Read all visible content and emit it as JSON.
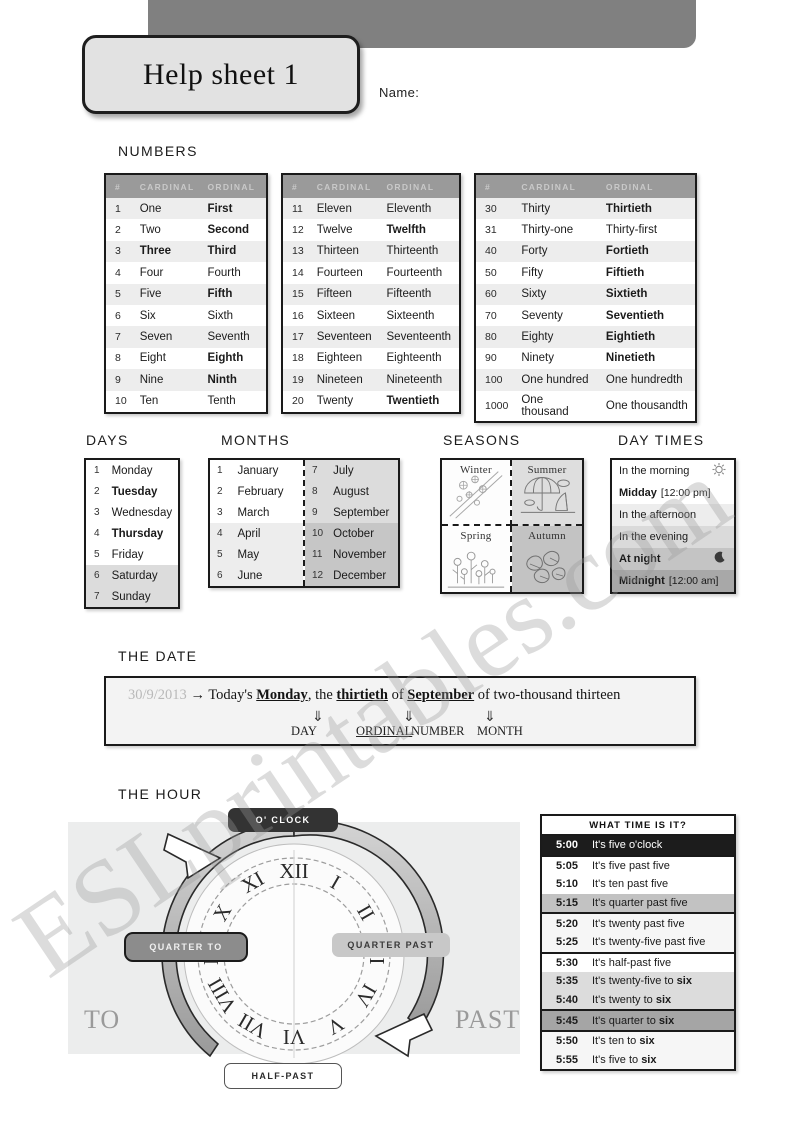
{
  "header": {
    "title": "Help sheet 1",
    "name_label": "Name:"
  },
  "sections": {
    "numbers": "NUMBERS",
    "days": "DAYS",
    "months": "MONTHS",
    "seasons": "SEASONS",
    "day_times": "DAY TIMES",
    "the_date": "THE DATE",
    "the_hour": "THE HOUR"
  },
  "numbers": {
    "columns": [
      "#",
      "CARDINAL",
      "ORDINAL"
    ],
    "table1": [
      {
        "n": "1",
        "cardinal": "One",
        "ordinal": "First",
        "cardinal_bold": false,
        "ordinal_bold": true
      },
      {
        "n": "2",
        "cardinal": "Two",
        "ordinal": "Second",
        "cardinal_bold": false,
        "ordinal_bold": true
      },
      {
        "n": "3",
        "cardinal": "Three",
        "ordinal": "Third",
        "cardinal_bold": true,
        "ordinal_bold": true
      },
      {
        "n": "4",
        "cardinal": "Four",
        "ordinal": "Fourth",
        "cardinal_bold": false,
        "ordinal_bold": false
      },
      {
        "n": "5",
        "cardinal": "Five",
        "ordinal": "Fifth",
        "cardinal_bold": false,
        "ordinal_bold": true
      },
      {
        "n": "6",
        "cardinal": "Six",
        "ordinal": "Sixth",
        "cardinal_bold": false,
        "ordinal_bold": false
      },
      {
        "n": "7",
        "cardinal": "Seven",
        "ordinal": "Seventh",
        "cardinal_bold": false,
        "ordinal_bold": false
      },
      {
        "n": "8",
        "cardinal": "Eight",
        "ordinal": "Eighth",
        "cardinal_bold": false,
        "ordinal_bold": true
      },
      {
        "n": "9",
        "cardinal": "Nine",
        "ordinal": "Ninth",
        "cardinal_bold": false,
        "ordinal_bold": true
      },
      {
        "n": "10",
        "cardinal": "Ten",
        "ordinal": "Tenth",
        "cardinal_bold": false,
        "ordinal_bold": false
      }
    ],
    "table2": [
      {
        "n": "11",
        "cardinal": "Eleven",
        "ordinal": "Eleventh",
        "cardinal_bold": false,
        "ordinal_bold": false
      },
      {
        "n": "12",
        "cardinal": "Twelve",
        "ordinal": "Twelfth",
        "cardinal_bold": false,
        "ordinal_bold": true
      },
      {
        "n": "13",
        "cardinal": "Thirteen",
        "ordinal": "Thirteenth",
        "cardinal_bold": false,
        "ordinal_bold": false
      },
      {
        "n": "14",
        "cardinal": "Fourteen",
        "ordinal": "Fourteenth",
        "cardinal_bold": false,
        "ordinal_bold": false
      },
      {
        "n": "15",
        "cardinal": "Fifteen",
        "ordinal": "Fifteenth",
        "cardinal_bold": false,
        "ordinal_bold": false
      },
      {
        "n": "16",
        "cardinal": "Sixteen",
        "ordinal": "Sixteenth",
        "cardinal_bold": false,
        "ordinal_bold": false
      },
      {
        "n": "17",
        "cardinal": "Seventeen",
        "ordinal": "Seventeenth",
        "cardinal_bold": false,
        "ordinal_bold": false
      },
      {
        "n": "18",
        "cardinal": "Eighteen",
        "ordinal": "Eighteenth",
        "cardinal_bold": false,
        "ordinal_bold": false
      },
      {
        "n": "19",
        "cardinal": "Nineteen",
        "ordinal": "Nineteenth",
        "cardinal_bold": false,
        "ordinal_bold": false
      },
      {
        "n": "20",
        "cardinal": "Twenty",
        "ordinal": "Twentieth",
        "cardinal_bold": false,
        "ordinal_bold": true
      }
    ],
    "table3": [
      {
        "n": "30",
        "cardinal": "Thirty",
        "ordinal": "Thirtieth",
        "cardinal_bold": false,
        "ordinal_bold": true
      },
      {
        "n": "31",
        "cardinal": "Thirty-one",
        "ordinal": "Thirty-first",
        "cardinal_bold": false,
        "ordinal_bold": false
      },
      {
        "n": "40",
        "cardinal": "Forty",
        "ordinal": "Fortieth",
        "cardinal_bold": false,
        "ordinal_bold": true
      },
      {
        "n": "50",
        "cardinal": "Fifty",
        "ordinal": "Fiftieth",
        "cardinal_bold": false,
        "ordinal_bold": true
      },
      {
        "n": "60",
        "cardinal": "Sixty",
        "ordinal": "Sixtieth",
        "cardinal_bold": false,
        "ordinal_bold": true
      },
      {
        "n": "70",
        "cardinal": "Seventy",
        "ordinal": "Seventieth",
        "cardinal_bold": false,
        "ordinal_bold": true
      },
      {
        "n": "80",
        "cardinal": "Eighty",
        "ordinal": "Eightieth",
        "cardinal_bold": false,
        "ordinal_bold": true
      },
      {
        "n": "90",
        "cardinal": "Ninety",
        "ordinal": "Ninetieth",
        "cardinal_bold": false,
        "ordinal_bold": true
      },
      {
        "n": "100",
        "cardinal": "One hundred",
        "ordinal": "One hundredth",
        "cardinal_bold": false,
        "ordinal_bold": false
      },
      {
        "n": "1000",
        "cardinal": "One thousand",
        "ordinal": "One thousandth",
        "cardinal_bold": false,
        "ordinal_bold": false
      }
    ]
  },
  "days": [
    {
      "n": "1",
      "label": "Monday",
      "bold": false,
      "shade": 0
    },
    {
      "n": "2",
      "label": "Tuesday",
      "bold": true,
      "shade": 0
    },
    {
      "n": "3",
      "label": "Wednesday",
      "bold": false,
      "shade": 0
    },
    {
      "n": "4",
      "label": "Thursday",
      "bold": true,
      "shade": 0
    },
    {
      "n": "5",
      "label": "Friday",
      "bold": false,
      "shade": 0
    },
    {
      "n": "6",
      "label": "Saturday",
      "bold": false,
      "shade": 2
    },
    {
      "n": "7",
      "label": "Sunday",
      "bold": false,
      "shade": 2
    }
  ],
  "months_left": [
    {
      "n": "1",
      "label": "January",
      "shade": 0
    },
    {
      "n": "2",
      "label": "February",
      "shade": 0
    },
    {
      "n": "3",
      "label": "March",
      "shade": 0
    },
    {
      "n": "4",
      "label": "April",
      "shade": 1
    },
    {
      "n": "5",
      "label": "May",
      "shade": 1
    },
    {
      "n": "6",
      "label": "June",
      "shade": 1
    }
  ],
  "months_right": [
    {
      "n": "7",
      "label": "July",
      "shade": 2
    },
    {
      "n": "8",
      "label": "August",
      "shade": 2
    },
    {
      "n": "9",
      "label": "September",
      "shade": 2
    },
    {
      "n": "10",
      "label": "October",
      "shade": 3
    },
    {
      "n": "11",
      "label": "November",
      "shade": 3
    },
    {
      "n": "12",
      "label": "December",
      "shade": 3
    }
  ],
  "seasons": [
    {
      "name": "Winter",
      "icon": "snowflakes-icon"
    },
    {
      "name": "Summer",
      "icon": "beach-umbrella-icon"
    },
    {
      "name": "Spring",
      "icon": "flowers-icon"
    },
    {
      "name": "Autumn",
      "icon": "leaves-icon"
    }
  ],
  "day_times": [
    {
      "label": "In the morning",
      "bracket": "",
      "bold": false,
      "shade": 0,
      "icon": "sun-icon"
    },
    {
      "label": "Midday",
      "bracket": "[12:00 pm]",
      "bold": true,
      "shade": 0,
      "icon": ""
    },
    {
      "label": "In the afternoon",
      "bracket": "",
      "bold": false,
      "shade": 1,
      "icon": ""
    },
    {
      "label": "In the evening",
      "bracket": "",
      "bold": false,
      "shade": 2,
      "icon": ""
    },
    {
      "label": "At night",
      "bracket": "",
      "bold": true,
      "shade": 3,
      "icon": "moon-icon"
    },
    {
      "label": "Midnight",
      "bracket": "[12:00 am]",
      "bold": true,
      "shade": 4,
      "icon": ""
    }
  ],
  "the_date": {
    "numeric": "30/9/2013",
    "arrow": "→",
    "pre": "Today's",
    "day": "Monday",
    "mid1": ", the",
    "ordinal": "thirtieth",
    "mid2": "of",
    "month": "September",
    "tail": "of two-thousand thirteen",
    "arrow_down": "⇓",
    "label_day": "DAY",
    "label_ordinal": "ORDINAL",
    "label_number": "NUMBER",
    "label_month": "MONTH"
  },
  "the_hour": {
    "oclock": "O' CLOCK",
    "quarter_to": "QUARTER TO",
    "quarter_past": "QUARTER PAST",
    "half_past": "HALF-PAST",
    "to": "TO",
    "past": "PAST",
    "roman_numerals": [
      "XII",
      "I",
      "II",
      "III",
      "IV",
      "V",
      "VI",
      "VII",
      "VIII",
      "IX",
      "X",
      "XI"
    ]
  },
  "what_time": {
    "title": "WHAT TIME IS IT?",
    "rows": [
      {
        "time": "5:00",
        "phrase": "It's five o'clock",
        "shade": "black",
        "bold_tail": ""
      },
      {
        "time": "5:05",
        "phrase": "It's five past five",
        "shade": "0",
        "bold_tail": ""
      },
      {
        "time": "5:10",
        "phrase": "It's ten past five",
        "shade": "0",
        "bold_tail": ""
      },
      {
        "time": "5:15",
        "phrase": "It's quarter past five",
        "shade": "3",
        "bold_tail": ""
      },
      {
        "time": "5:20",
        "phrase": "It's twenty past five",
        "shade": "1",
        "bold_tail": ""
      },
      {
        "time": "5:25",
        "phrase": "It's twenty-five past five",
        "shade": "1",
        "bold_tail": ""
      },
      {
        "time": "5:30",
        "phrase": "It's half-past five",
        "shade": "0",
        "bold_tail": ""
      },
      {
        "time": "5:35",
        "phrase": "It's twenty-five to ",
        "shade": "2",
        "bold_tail": "six"
      },
      {
        "time": "5:40",
        "phrase": "It's twenty to ",
        "shade": "2",
        "bold_tail": "six"
      },
      {
        "time": "5:45",
        "phrase": "It's quarter to ",
        "shade": "4",
        "bold_tail": "six"
      },
      {
        "time": "5:50",
        "phrase": "It's ten to ",
        "shade": "1",
        "bold_tail": "six"
      },
      {
        "time": "5:55",
        "phrase": "It's five to ",
        "shade": "1",
        "bold_tail": "six"
      }
    ]
  },
  "watermark": {
    "text": "ESLprintables.com"
  },
  "colors": {
    "banner": "#808080",
    "table_header": "#9a9a9a",
    "dark_pill": "#333333",
    "panel": "#eceded"
  }
}
